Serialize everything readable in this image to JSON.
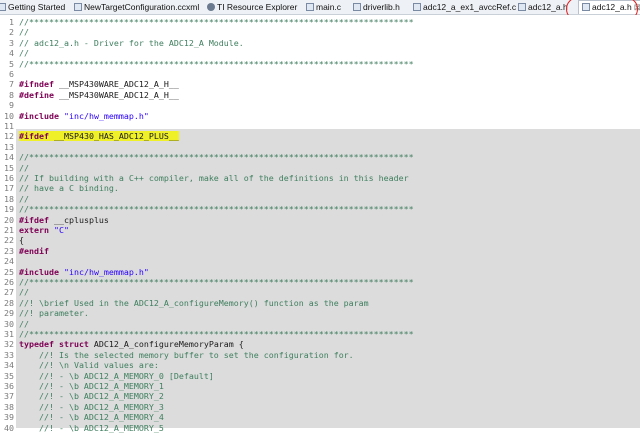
{
  "tabs": [
    {
      "label": "Getting Started",
      "icon": "file-icon"
    },
    {
      "label": "NewTargetConfiguration.ccxml",
      "icon": "file-icon"
    },
    {
      "label": "TI Resource Explorer",
      "icon": "gear-icon"
    },
    {
      "label": "main.c",
      "icon": "file-icon"
    },
    {
      "label": "driverlib.h",
      "icon": "file-icon"
    },
    {
      "label": "adc12_a_ex1_avccRef.c",
      "icon": "file-icon"
    },
    {
      "label": "adc12_a.h",
      "icon": "file-icon"
    },
    {
      "label": "adc12_a.h",
      "icon": "file-icon",
      "active": true,
      "close": "⊠"
    }
  ],
  "highlight_color": "#f0f028",
  "lines": [
    {
      "n": "1",
      "t": "//*****************************************************************************"
    },
    {
      "n": "2",
      "t": "//"
    },
    {
      "n": "3",
      "t": "// adc12_a.h - Driver for the ADC12_A Module."
    },
    {
      "n": "4",
      "t": "//"
    },
    {
      "n": "5",
      "t": "//*****************************************************************************"
    },
    {
      "n": "6",
      "t": ""
    },
    {
      "n": "7",
      "t": "#ifndef __MSP430WARE_ADC12_A_H__"
    },
    {
      "n": "8",
      "t": "#define __MSP430WARE_ADC12_A_H__"
    },
    {
      "n": "9",
      "t": ""
    },
    {
      "n": "10",
      "t": "#include \"inc/hw_memmap.h\""
    },
    {
      "n": "11",
      "t": ""
    },
    {
      "n": "12",
      "t": "#ifdef __MSP430_HAS_ADC12_PLUS__"
    },
    {
      "n": "13",
      "t": ""
    },
    {
      "n": "14",
      "t": "//*****************************************************************************"
    },
    {
      "n": "15",
      "t": "//"
    },
    {
      "n": "16",
      "t": "// If building with a C++ compiler, make all of the definitions in this header"
    },
    {
      "n": "17",
      "t": "// have a C binding."
    },
    {
      "n": "18",
      "t": "//"
    },
    {
      "n": "19",
      "t": "//*****************************************************************************"
    },
    {
      "n": "20",
      "t": "#ifdef __cplusplus"
    },
    {
      "n": "21",
      "t": "extern \"C\""
    },
    {
      "n": "22",
      "t": "{"
    },
    {
      "n": "23",
      "t": "#endif"
    },
    {
      "n": "24",
      "t": ""
    },
    {
      "n": "25",
      "t": "#include \"inc/hw_memmap.h\""
    },
    {
      "n": "26",
      "t": "//*****************************************************************************"
    },
    {
      "n": "27",
      "t": "//"
    },
    {
      "n": "28",
      "t": "//! \\brief Used in the ADC12_A_configureMemory() function as the param"
    },
    {
      "n": "29",
      "t": "//! parameter."
    },
    {
      "n": "30",
      "t": "//"
    },
    {
      "n": "31",
      "t": "//*****************************************************************************"
    },
    {
      "n": "32",
      "t": "typedef struct ADC12_A_configureMemoryParam {"
    },
    {
      "n": "33",
      "t": "    //! Is the selected memory buffer to set the configuration for."
    },
    {
      "n": "34",
      "t": "    //! \\n Valid values are:"
    },
    {
      "n": "35",
      "t": "    //! - \\b ADC12_A_MEMORY_0 [Default]"
    },
    {
      "n": "36",
      "t": "    //! - \\b ADC12_A_MEMORY_1"
    },
    {
      "n": "37",
      "t": "    //! - \\b ADC12_A_MEMORY_2"
    },
    {
      "n": "38",
      "t": "    //! - \\b ADC12_A_MEMORY_3"
    },
    {
      "n": "39",
      "t": "    //! - \\b ADC12_A_MEMORY_4"
    },
    {
      "n": "40",
      "t": "    //! - \\b ADC12_A_MEMORY_5"
    }
  ]
}
